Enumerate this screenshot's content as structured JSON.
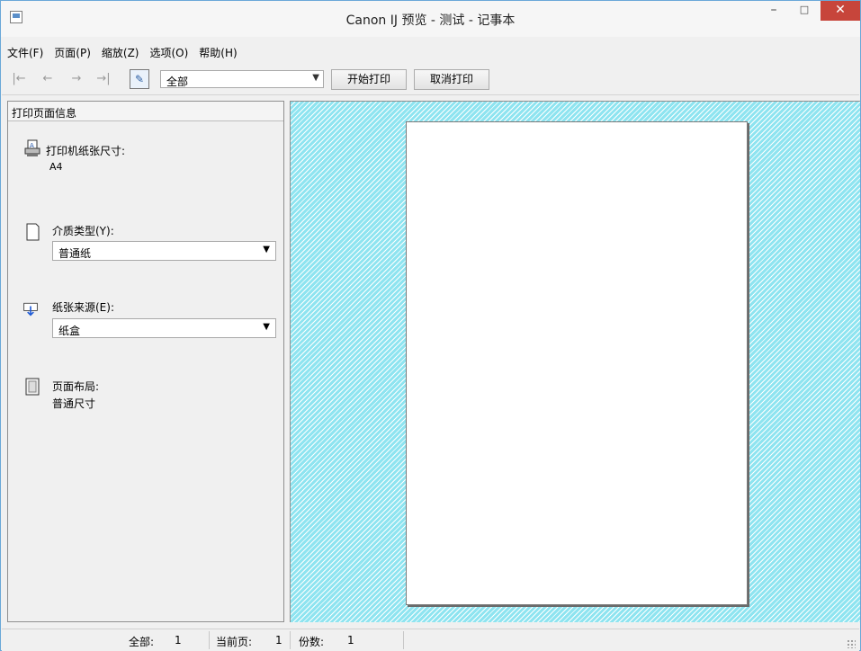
{
  "window": {
    "title": "Canon IJ 预览 - 测试 - 记事本",
    "minimize_glyph": "–",
    "maximize_glyph": "□",
    "close_glyph": "✕"
  },
  "menu": [
    {
      "label": "文件(F)"
    },
    {
      "label": "页面(P)"
    },
    {
      "label": "缩放(Z)"
    },
    {
      "label": "选项(O)"
    },
    {
      "label": "帮助(H)"
    }
  ],
  "toolbar": {
    "page_range_value": "全部",
    "start_print_label": "开始打印",
    "cancel_print_label": "取消打印",
    "nav_first_glyph": "|←",
    "nav_prev_glyph": "←",
    "nav_next_glyph": "→",
    "nav_last_glyph": "→|"
  },
  "panel": {
    "header": "打印页面信息",
    "paper_size_label": "打印机纸张尺寸:",
    "paper_size_value": "A4",
    "media_type_label": "介质类型(Y):",
    "media_type_value": "普通纸",
    "paper_source_label": "纸张来源(E):",
    "paper_source_value": "纸盒",
    "layout_label": "页面布局:",
    "layout_value": "普通尺寸"
  },
  "status": {
    "total_label": "全部:",
    "total_value": "1",
    "current_label": "当前页:",
    "current_value": "1",
    "copies_label": "份数:",
    "copies_value": "1"
  },
  "colors": {
    "preview_bg": "#8ee4f0",
    "close_button": "#c7453b"
  },
  "icons": [
    "app-icon",
    "minimize-icon",
    "maximize-icon",
    "close-icon",
    "first-page-icon",
    "prev-page-icon",
    "next-page-icon",
    "last-page-icon",
    "page-select-icon",
    "printer-icon",
    "media-icon",
    "paper-source-icon",
    "layout-icon",
    "dropdown-arrow-icon"
  ]
}
